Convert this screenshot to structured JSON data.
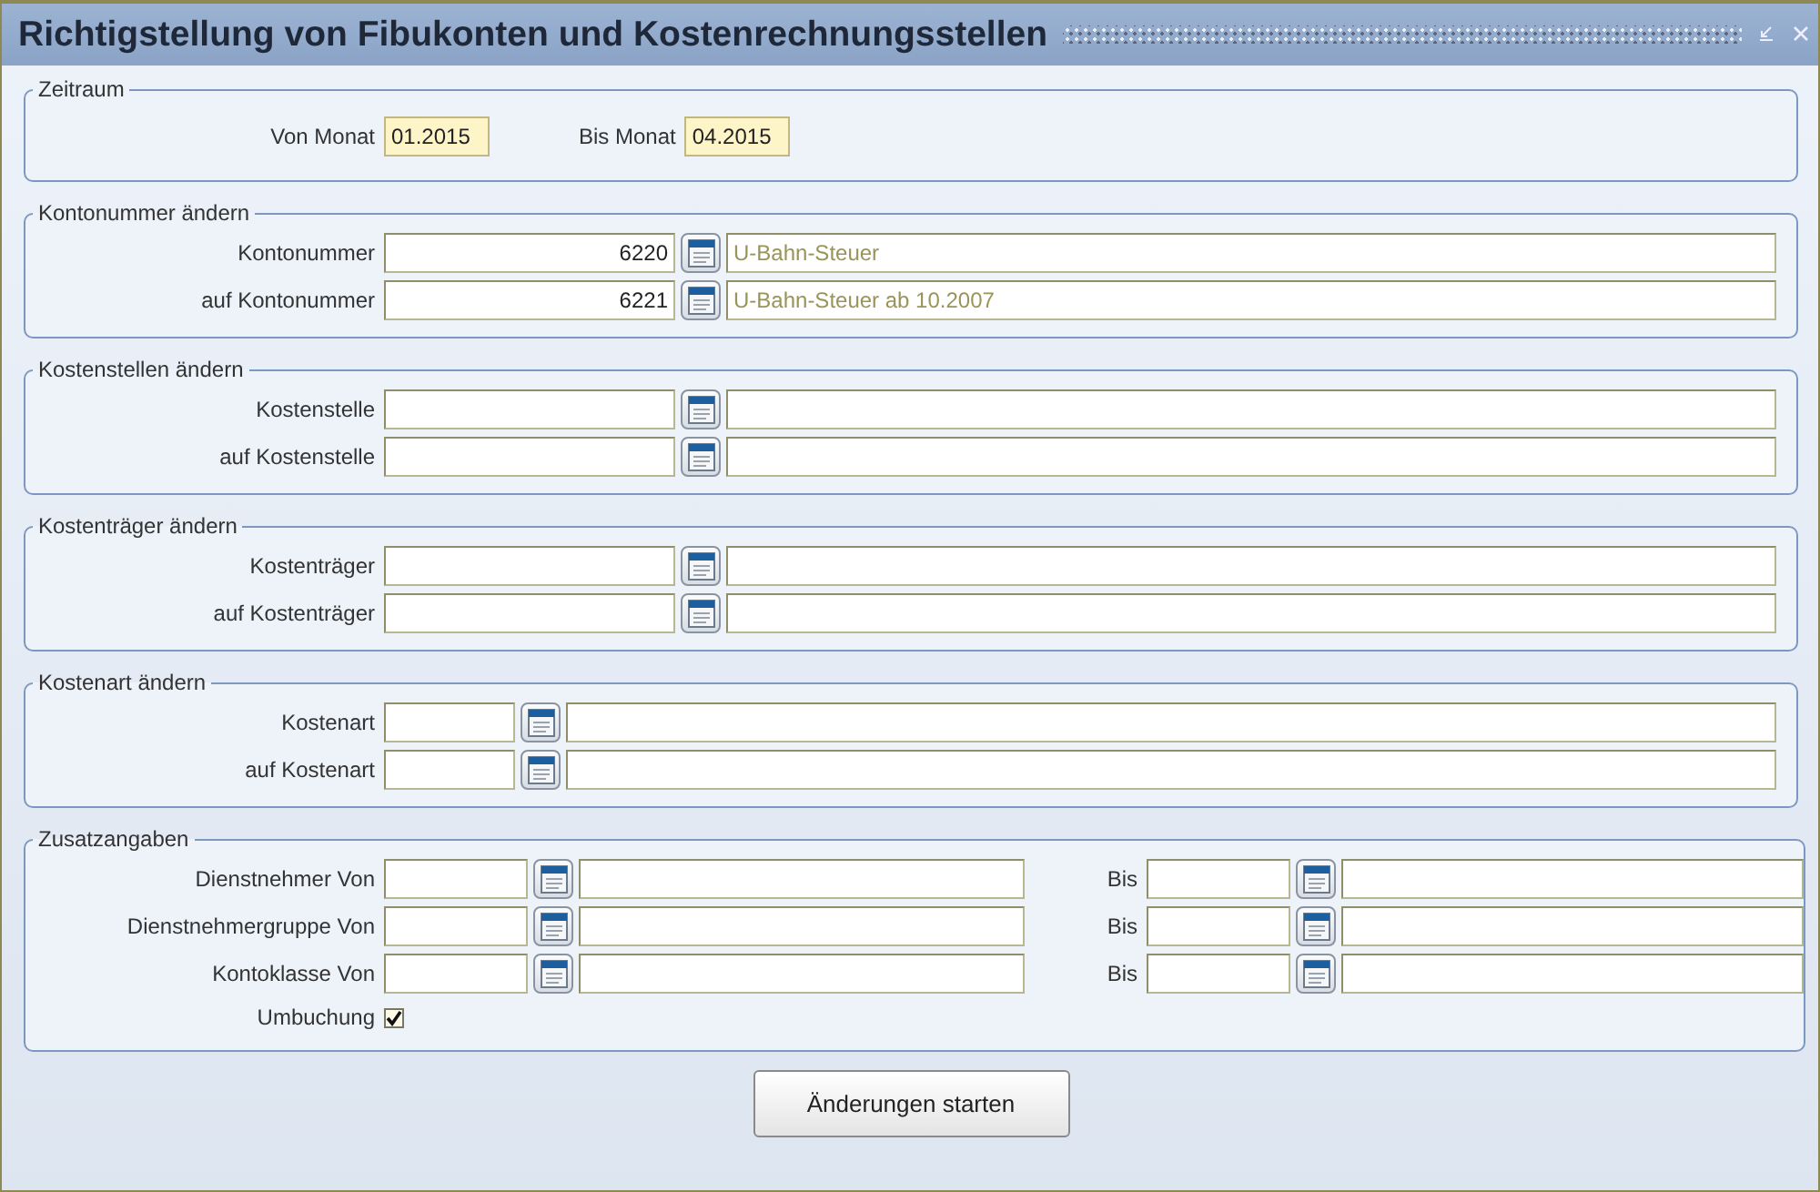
{
  "window": {
    "title": "Richtigstellung von Fibukonten und Kostenrechnungsstellen"
  },
  "zeitraum": {
    "legend": "Zeitraum",
    "fields": [
      {
        "label": "Von Monat",
        "value": "01.2015"
      },
      {
        "label": "Bis Monat",
        "value": "04.2015"
      }
    ]
  },
  "sections": [
    {
      "legend": "Kontonummer ändern",
      "kind": "wide",
      "rows": [
        {
          "label": "Kontonummer",
          "code": "6220",
          "description": "U-Bahn-Steuer"
        },
        {
          "label": "auf Kontonummer",
          "code": "6221",
          "description": "U-Bahn-Steuer ab 10.2007"
        }
      ]
    },
    {
      "legend": "Kostenstellen ändern",
      "kind": "wide",
      "rows": [
        {
          "label": "Kostenstelle"
        },
        {
          "label": "auf Kostenstelle"
        }
      ]
    },
    {
      "legend": "Kostenträger ändern",
      "kind": "wide",
      "rows": [
        {
          "label": "Kostenträger"
        },
        {
          "label": "auf Kostenträger"
        }
      ]
    },
    {
      "legend": "Kostenart ändern",
      "kind": "small",
      "rows": [
        {
          "label": "Kostenart"
        },
        {
          "label": "auf Kostenart"
        }
      ]
    }
  ],
  "zusatz": {
    "legend": "Zusatzangaben",
    "rows": [
      {
        "label": "Dienstnehmer Von",
        "bis_label": "Bis"
      },
      {
        "label": "Dienstnehmergruppe Von",
        "bis_label": "Bis"
      },
      {
        "label": "Kontoklasse Von",
        "bis_label": "Bis"
      }
    ],
    "checkbox": {
      "label": "Umbuchung",
      "checked": true
    }
  },
  "start_button": "Änderungen starten"
}
